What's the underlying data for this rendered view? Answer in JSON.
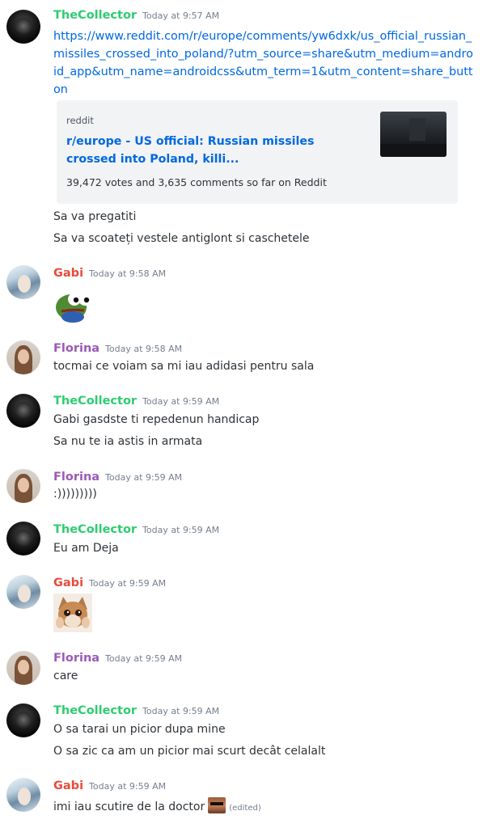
{
  "users": {
    "collector": {
      "name": "TheCollector",
      "color": "#2ecc71"
    },
    "gabi": {
      "name": "Gabi",
      "color": "#e74c3c"
    },
    "florina": {
      "name": "Florina",
      "color": "#9b59b6"
    }
  },
  "messages": [
    {
      "author": "TheCollector",
      "time": "Today at 9:57 AM",
      "link": "https://www.reddit.com/r/europe/comments/yw6dxk/us_official_russian_missiles_crossed_into_poland/?utm_source=share&utm_medium=android_app&utm_name=androidcss&utm_term=1&utm_content=share_button",
      "embed": {
        "provider": "reddit",
        "title": "r/europe - US official: Russian missiles crossed into Poland, killi...",
        "description": "39,472 votes and 3,635 comments so far on Reddit",
        "thumbnail": "dark-street-photo"
      },
      "lines": [
        "Sa va pregatiti",
        "Sa va scoateți vestele antiglont si caschetele"
      ]
    },
    {
      "author": "Gabi",
      "time": "Today at 9:58 AM",
      "emoji": "pepe-frog-emoji"
    },
    {
      "author": "Florina",
      "time": "Today at 9:58 AM",
      "lines": [
        "tocmai ce voiam sa mi iau adidasi pentru sala"
      ]
    },
    {
      "author": "TheCollector",
      "time": "Today at 9:59 AM",
      "lines": [
        "Gabi gasdste ti repedenun handicap",
        "Sa nu te ia astis in armata"
      ]
    },
    {
      "author": "Florina",
      "time": "Today at 9:59 AM",
      "lines": [
        ":)))))))))"
      ]
    },
    {
      "author": "TheCollector",
      "time": "Today at 9:59 AM",
      "lines": [
        "Eu am Deja"
      ]
    },
    {
      "author": "Gabi",
      "time": "Today at 9:59 AM",
      "emoji": "crying-cat-emoji"
    },
    {
      "author": "Florina",
      "time": "Today at 9:59 AM",
      "lines": [
        "care"
      ]
    },
    {
      "author": "TheCollector",
      "time": "Today at 9:59 AM",
      "lines": [
        "O sa tarai un picior dupa mine",
        "O sa zic ca am un picior mai scurt decât celalalt"
      ]
    },
    {
      "author": "Gabi",
      "time": "Today at 9:59 AM",
      "lines": [
        "imi iau scutire de la doctor"
      ],
      "inline_emoji": "deal-with-it-emoji",
      "edited_label": "(edited)"
    }
  ]
}
